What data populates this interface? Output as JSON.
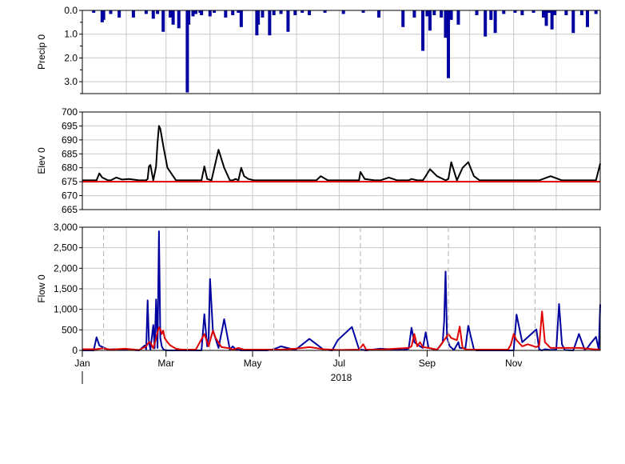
{
  "chart_data": [
    {
      "type": "bar",
      "panel": "precip",
      "ylabel": "Precip 0",
      "ylim": [
        0,
        3.5
      ],
      "y_inverted": true,
      "yticks": [
        "0.0",
        "1.0",
        "2.0",
        "3.0"
      ],
      "grid": true,
      "series": [
        {
          "color": "#0000a0",
          "x": [
            8,
            14,
            15,
            20,
            26,
            36,
            45,
            50,
            53,
            57,
            62,
            64,
            68,
            74,
            75,
            78,
            80,
            83,
            84,
            90,
            93,
            101,
            106,
            110,
            112,
            123,
            124,
            127,
            132,
            135,
            140,
            145,
            150,
            155,
            160,
            171,
            184,
            198,
            209,
            226,
            234,
            240,
            243,
            245,
            248,
            253,
            256,
            258,
            260,
            265,
            278,
            284,
            288,
            291,
            297,
            305,
            310,
            318,
            325,
            327,
            329,
            331,
            333,
            341,
            346,
            352,
            356,
            362
          ],
          "values": [
            0.1,
            0.5,
            0.4,
            0.15,
            0.3,
            0.3,
            0.15,
            0.35,
            0.15,
            0.9,
            0.3,
            0.6,
            0.75,
            3.45,
            0.6,
            0.25,
            0.15,
            0.1,
            0.2,
            0.25,
            0.1,
            0.3,
            0.2,
            0.1,
            0.7,
            1.05,
            0.6,
            0.3,
            1.05,
            0.2,
            0.15,
            0.9,
            0.2,
            0.1,
            0.2,
            0.1,
            0.15,
            0.1,
            0.3,
            0.7,
            0.3,
            1.7,
            0.25,
            0.85,
            0.2,
            0.3,
            1.15,
            2.85,
            0.4,
            0.6,
            0.2,
            1.1,
            0.4,
            0.95,
            0.15,
            0.1,
            0.2,
            0.1,
            0.3,
            0.65,
            0.1,
            0.8,
            0.2,
            0.2,
            0.95,
            0.2,
            0.7,
            0.15
          ]
        }
      ]
    },
    {
      "type": "line",
      "panel": "elev",
      "ylabel": "Elev 0",
      "ylim": [
        665,
        700
      ],
      "yticks": [
        "665",
        "670",
        "675",
        "680",
        "685",
        "690",
        "695",
        "700"
      ],
      "grid": true,
      "series": [
        {
          "color": "#000000",
          "x": [
            0,
            10,
            12,
            14,
            18,
            20,
            24,
            28,
            33,
            40,
            45,
            46,
            47,
            48,
            50,
            52,
            53,
            54,
            55,
            57,
            60,
            66,
            70,
            72,
            74,
            76,
            78,
            80,
            84,
            86,
            88,
            91,
            96,
            100,
            104,
            106,
            108,
            110,
            112,
            114,
            117,
            121,
            126,
            131,
            136,
            140,
            144,
            150,
            165,
            168,
            173,
            180,
            195,
            196,
            199,
            206,
            210,
            216,
            222,
            226,
            230,
            232,
            236,
            240,
            242,
            245,
            250,
            256,
            258,
            260,
            264,
            268,
            272,
            276,
            280,
            284,
            290,
            296,
            310,
            322,
            330,
            338,
            350,
            358,
            362,
            365
          ],
          "y": [
            675.5,
            675.5,
            678,
            676.5,
            675.5,
            675.5,
            676.5,
            675.8,
            676,
            675.5,
            675.5,
            676,
            680.5,
            681,
            675.5,
            680.5,
            689,
            695,
            694,
            688,
            680,
            675.5,
            675.5,
            675.5,
            675.5,
            675.5,
            675.5,
            675.5,
            675.5,
            680.5,
            676,
            675.5,
            686.5,
            680,
            675.5,
            675.5,
            676,
            675.5,
            680,
            677,
            676,
            675.5,
            675.5,
            675.5,
            675.5,
            675.5,
            675.5,
            675.5,
            675.5,
            677,
            675.5,
            675.5,
            675.5,
            678.5,
            676,
            675.5,
            675.5,
            676.5,
            675.5,
            675.5,
            675.5,
            676,
            675.5,
            675.5,
            677,
            679.5,
            677,
            675.5,
            676,
            682,
            675.5,
            680,
            682,
            677,
            675.5,
            675.5,
            675.5,
            675.5,
            675.5,
            675.5,
            677,
            675.5,
            675.5,
            675.5,
            675.5,
            681.5
          ]
        },
        {
          "color": "#e00000",
          "x": [
            0,
            365
          ],
          "y": [
            675,
            675
          ]
        }
      ]
    },
    {
      "type": "line",
      "panel": "flow",
      "ylabel": "Flow 0",
      "ylim": [
        0,
        3000
      ],
      "yticks": [
        "0",
        "500",
        "1,000",
        "1,500",
        "2,000",
        "2,500",
        "3,000"
      ],
      "xticks": [
        "Jan",
        "Mar",
        "May",
        "Jul",
        "Sep",
        "Nov"
      ],
      "xlabel": "2018",
      "grid": true,
      "series": [
        {
          "color": "#0000a0",
          "x": [
            0,
            8,
            10,
            12,
            18,
            22,
            25,
            28,
            32,
            36,
            40,
            44,
            45,
            46,
            47,
            48,
            50,
            51,
            52,
            53,
            54,
            55,
            56,
            57,
            58,
            60,
            65,
            70,
            80,
            84,
            86,
            88,
            89,
            90,
            92,
            96,
            100,
            104,
            106,
            108,
            112,
            130,
            135,
            140,
            150,
            160,
            170,
            176,
            180,
            190,
            195,
            200,
            210,
            226,
            230,
            232,
            234,
            238,
            240,
            242,
            244,
            250,
            254,
            255,
            256,
            257,
            259,
            262,
            265,
            266,
            270,
            272,
            276,
            278,
            280,
            284,
            300,
            304,
            306,
            310,
            320,
            322,
            324,
            326,
            330,
            334,
            336,
            338,
            340,
            346,
            350,
            354,
            356,
            358,
            362,
            364,
            365
          ],
          "y": [
            0,
            0,
            320,
            120,
            20,
            30,
            20,
            30,
            20,
            10,
            0,
            120,
            30,
            1220,
            200,
            20,
            620,
            50,
            1240,
            60,
            2900,
            300,
            100,
            30,
            10,
            0,
            0,
            0,
            0,
            0,
            880,
            100,
            300,
            1740,
            500,
            60,
            760,
            20,
            100,
            30,
            0,
            0,
            30,
            100,
            10,
            280,
            20,
            0,
            250,
            570,
            30,
            0,
            40,
            10,
            40,
            550,
            200,
            100,
            60,
            440,
            60,
            10,
            200,
            700,
            1920,
            300,
            100,
            10,
            200,
            60,
            50,
            600,
            20,
            0,
            0,
            0,
            0,
            0,
            870,
            200,
            510,
            20,
            0,
            30,
            10,
            20,
            1130,
            150,
            10,
            0,
            400,
            20,
            60,
            160,
            330,
            20,
            1120
          ]
        },
        {
          "color": "#e00000",
          "x": [
            0,
            10,
            14,
            20,
            30,
            40,
            45,
            47,
            48,
            50,
            52,
            53,
            54,
            55,
            56,
            57,
            58,
            60,
            62,
            66,
            70,
            80,
            86,
            88,
            89,
            92,
            94,
            98,
            104,
            106,
            110,
            114,
            130,
            140,
            150,
            160,
            170,
            180,
            195,
            198,
            200,
            210,
            230,
            232,
            234,
            236,
            238,
            240,
            244,
            250,
            252,
            256,
            258,
            260,
            264,
            266,
            268,
            270,
            272,
            280,
            290,
            300,
            302,
            304,
            306,
            310,
            314,
            320,
            322,
            324,
            326,
            330,
            340,
            350,
            360,
            365
          ],
          "y": [
            30,
            30,
            50,
            20,
            40,
            10,
            100,
            200,
            190,
            50,
            300,
            450,
            560,
            520,
            400,
            480,
            300,
            200,
            120,
            40,
            20,
            20,
            400,
            200,
            100,
            480,
            300,
            80,
            50,
            20,
            60,
            20,
            20,
            20,
            40,
            80,
            30,
            10,
            20,
            150,
            20,
            20,
            60,
            100,
            400,
            100,
            200,
            80,
            60,
            20,
            100,
            300,
            400,
            300,
            250,
            580,
            60,
            30,
            20,
            20,
            20,
            20,
            140,
            400,
            250,
            100,
            150,
            80,
            120,
            950,
            200,
            60,
            60,
            60,
            30,
            20
          ]
        }
      ]
    }
  ]
}
